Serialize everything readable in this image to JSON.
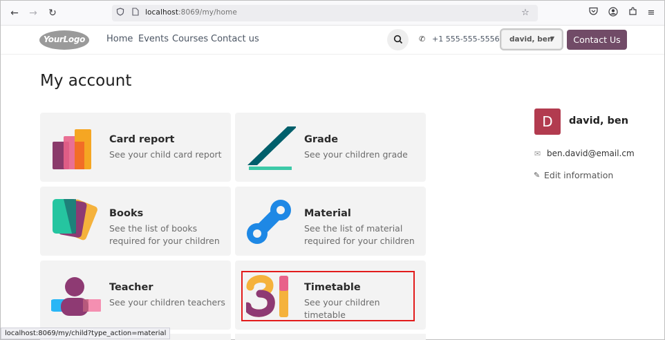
{
  "browser": {
    "url_host": "localhost",
    "url_path": ":8069/my/home",
    "status_url": "localhost:8069/my/child?type_action=material"
  },
  "header": {
    "logo_text": "YourLogo",
    "menu": [
      "Home",
      "Events",
      "Courses",
      "Contact us"
    ],
    "phone": "+1 555-555-5556",
    "user": "david, ben",
    "contact_button": "Contact Us"
  },
  "page": {
    "title": "My account",
    "cards": [
      {
        "title": "Card report",
        "desc": "See your child card report",
        "icon": "card-report-icon"
      },
      {
        "title": "Grade",
        "desc": "See your children grade",
        "icon": "grade-icon"
      },
      {
        "title": "Books",
        "desc": "See the list of books required for your children",
        "icon": "books-icon"
      },
      {
        "title": "Material",
        "desc": "See the list of material required for your children",
        "icon": "material-icon"
      },
      {
        "title": "Teacher",
        "desc": "See your children teachers",
        "icon": "teacher-icon"
      },
      {
        "title": "Timetable",
        "desc": "See your children timetable",
        "icon": "timetable-icon"
      }
    ]
  },
  "profile": {
    "avatar_letter": "D",
    "name": "david, ben",
    "email": "ben.david@email.cm",
    "edit_label": "Edit information"
  },
  "colors": {
    "brand": "#714b67",
    "avatar": "#b23b4f",
    "highlight": "#e21b1b"
  }
}
